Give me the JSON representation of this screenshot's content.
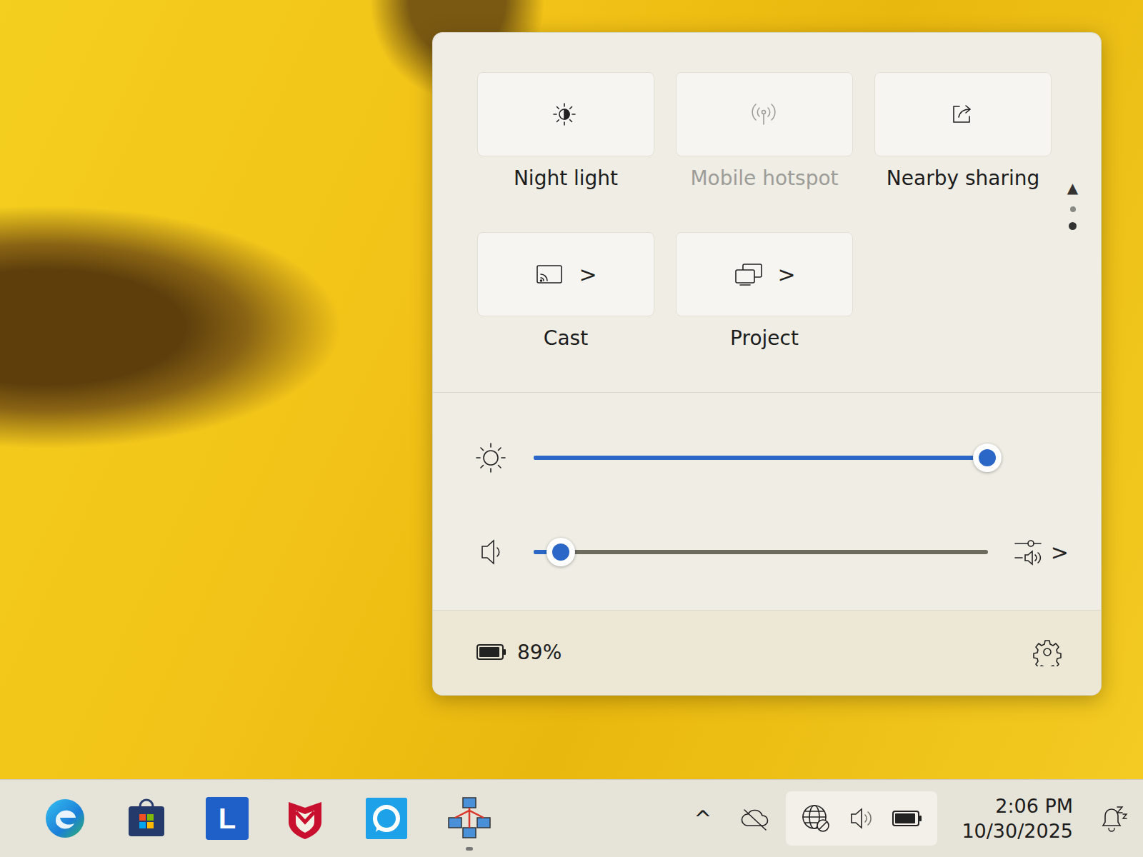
{
  "quick_settings": {
    "tiles": [
      {
        "label": "Night light",
        "kind": "nightlight",
        "on": false,
        "disabled": false,
        "chevron": ""
      },
      {
        "label": "Mobile hotspot",
        "kind": "hotspot",
        "on": false,
        "disabled": true,
        "chevron": ""
      },
      {
        "label": "Nearby sharing",
        "kind": "sharing",
        "on": false,
        "disabled": false,
        "chevron": ""
      },
      {
        "label": "Cast",
        "kind": "cast",
        "on": false,
        "disabled": false,
        "chevron": ">"
      },
      {
        "label": "Project",
        "kind": "project",
        "on": false,
        "disabled": false,
        "chevron": ">"
      }
    ],
    "pager": {
      "up": "▲",
      "dots": [
        {
          "selected": false
        },
        {
          "selected": true
        }
      ]
    },
    "brightness": {
      "level": 0.97
    },
    "volume": {
      "level": 0.06,
      "muted": false,
      "mixer_chevron": ">"
    },
    "battery": {
      "text": "89%"
    }
  },
  "taskbar": {
    "apps": [
      {
        "kind": "edge",
        "running": false
      },
      {
        "kind": "store",
        "running": false
      },
      {
        "kind": "letter",
        "label": "L",
        "running": false
      },
      {
        "kind": "mcafee",
        "running": false
      },
      {
        "kind": "alexa",
        "running": false
      },
      {
        "kind": "network",
        "running": true
      }
    ],
    "tray": {
      "overflow": "^",
      "quick_settings_open": true,
      "time": "2:06 PM",
      "date": "10/30/2025",
      "do_not_disturb": true
    }
  }
}
